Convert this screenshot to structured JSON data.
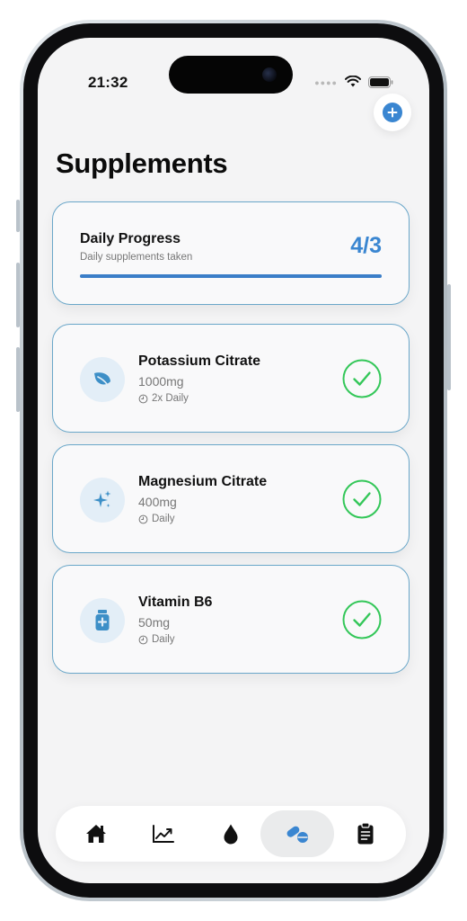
{
  "status_bar": {
    "time": "21:32"
  },
  "header": {
    "title": "Supplements"
  },
  "progress": {
    "title": "Daily Progress",
    "subtitle": "Daily supplements taken",
    "count": "4/3",
    "fill_fraction": 1.0
  },
  "supplements": [
    {
      "name": "Potassium Citrate",
      "dose": "1000mg",
      "frequency": "2x Daily",
      "icon": "leaf-icon",
      "taken": true
    },
    {
      "name": "Magnesium Citrate",
      "dose": "400mg",
      "frequency": "Daily",
      "icon": "sparkles-icon",
      "taken": true
    },
    {
      "name": "Vitamin B6",
      "dose": "50mg",
      "frequency": "Daily",
      "icon": "medicine-bottle-icon",
      "taken": true
    }
  ],
  "tabs": [
    {
      "icon": "house-icon",
      "active": false
    },
    {
      "icon": "trend-chart-icon",
      "active": false
    },
    {
      "icon": "drop-icon",
      "active": false
    },
    {
      "icon": "pills-icon",
      "active": true
    },
    {
      "icon": "clipboard-icon",
      "active": false
    }
  ],
  "colors": {
    "accent": "#3a86d1",
    "check_green": "#34c759",
    "card_border": "#6aa7c9",
    "icon_circle": "#e3eef7",
    "icon_fill": "#3d8fc7"
  }
}
